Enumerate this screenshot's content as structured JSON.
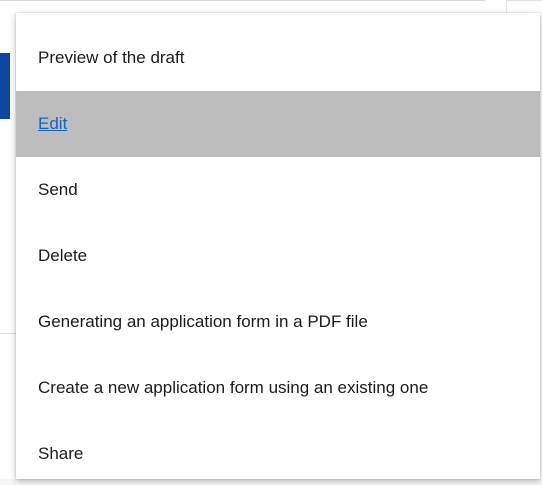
{
  "menu": {
    "items": [
      {
        "label": "Preview of the draft"
      },
      {
        "label": "Edit",
        "active": true
      },
      {
        "label": "Send"
      },
      {
        "label": "Delete"
      },
      {
        "label": "Generating an application form in a PDF file"
      },
      {
        "label": "Create a new application form using an existing one"
      },
      {
        "label": "Share"
      }
    ]
  },
  "colors": {
    "highlight": "#bdbdbd",
    "link": "#1565c0",
    "accent": "#0d47a1"
  }
}
